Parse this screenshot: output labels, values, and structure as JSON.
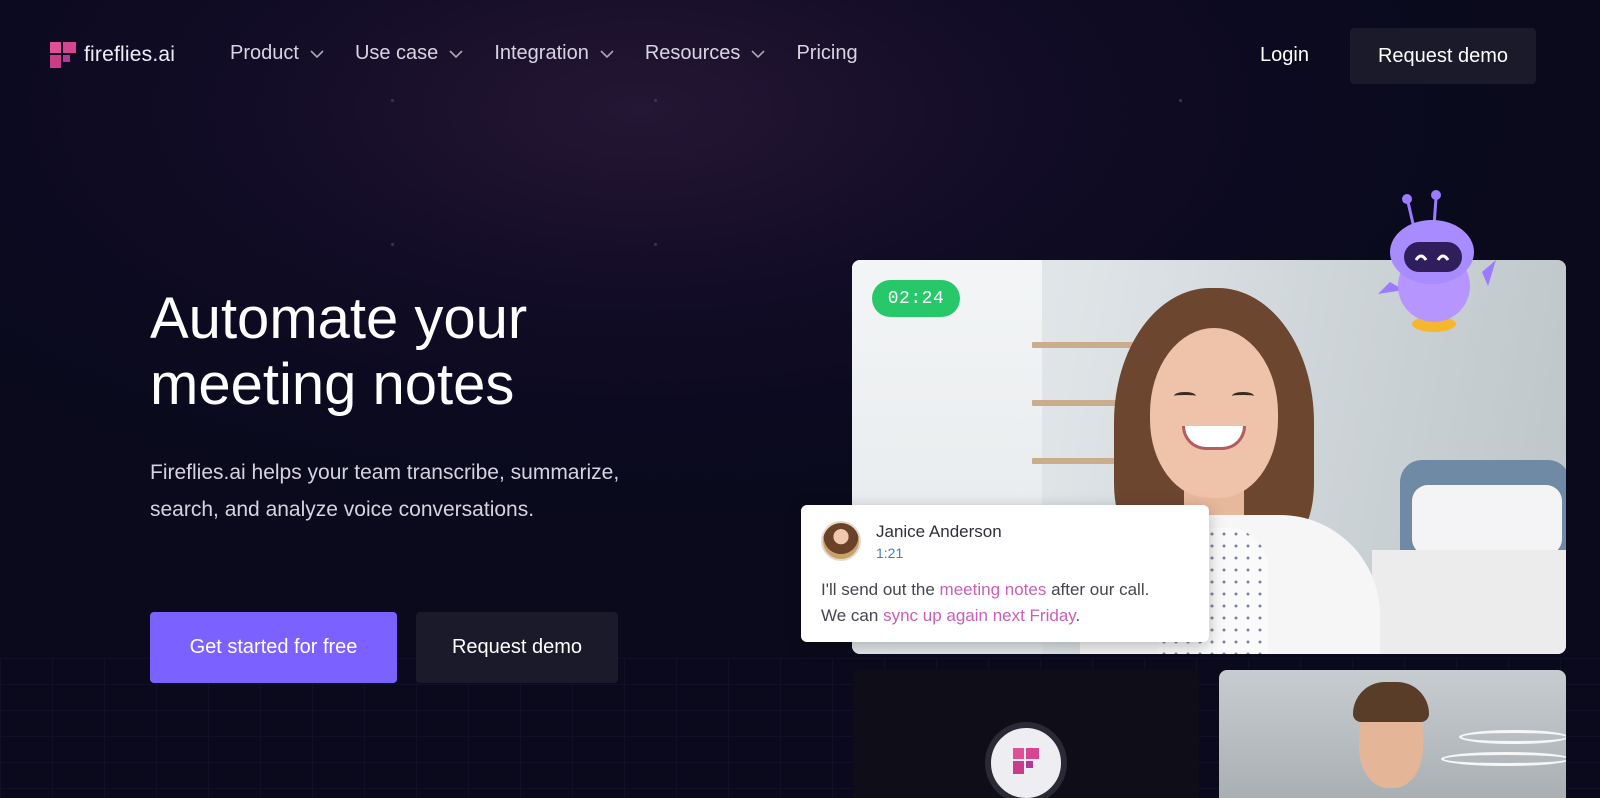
{
  "brand": {
    "name": "fireflies.ai",
    "color": "#d6458f"
  },
  "nav": {
    "items": [
      {
        "label": "Product",
        "has_dropdown": true
      },
      {
        "label": "Use case",
        "has_dropdown": true
      },
      {
        "label": "Integration",
        "has_dropdown": true
      },
      {
        "label": "Resources",
        "has_dropdown": true
      },
      {
        "label": "Pricing",
        "has_dropdown": false
      }
    ],
    "login": "Login",
    "request_demo": "Request demo"
  },
  "hero": {
    "headline_line1": "Automate your",
    "headline_line2": "meeting notes",
    "subhead_line1": "Fireflies.ai helps your team transcribe, summarize,",
    "subhead_line2": "search, and analyze voice conversations.",
    "cta_primary": "Get started for free",
    "cta_secondary": "Request demo",
    "accent_color": "#7b61ff"
  },
  "meeting": {
    "timer": "02:24",
    "transcript": {
      "speaker": "Janice Anderson",
      "timestamp": "1:21",
      "text_part1": "I'll send out the ",
      "highlight1": "meeting notes",
      "text_part2": " after our call.",
      "text_part3": "We can ",
      "highlight2": "sync up again next Friday",
      "text_part4": "."
    }
  },
  "icons": {
    "logo": "fireflies-logo-icon",
    "chevron": "chevron-down-icon",
    "robot": "robot-mascot-icon"
  }
}
